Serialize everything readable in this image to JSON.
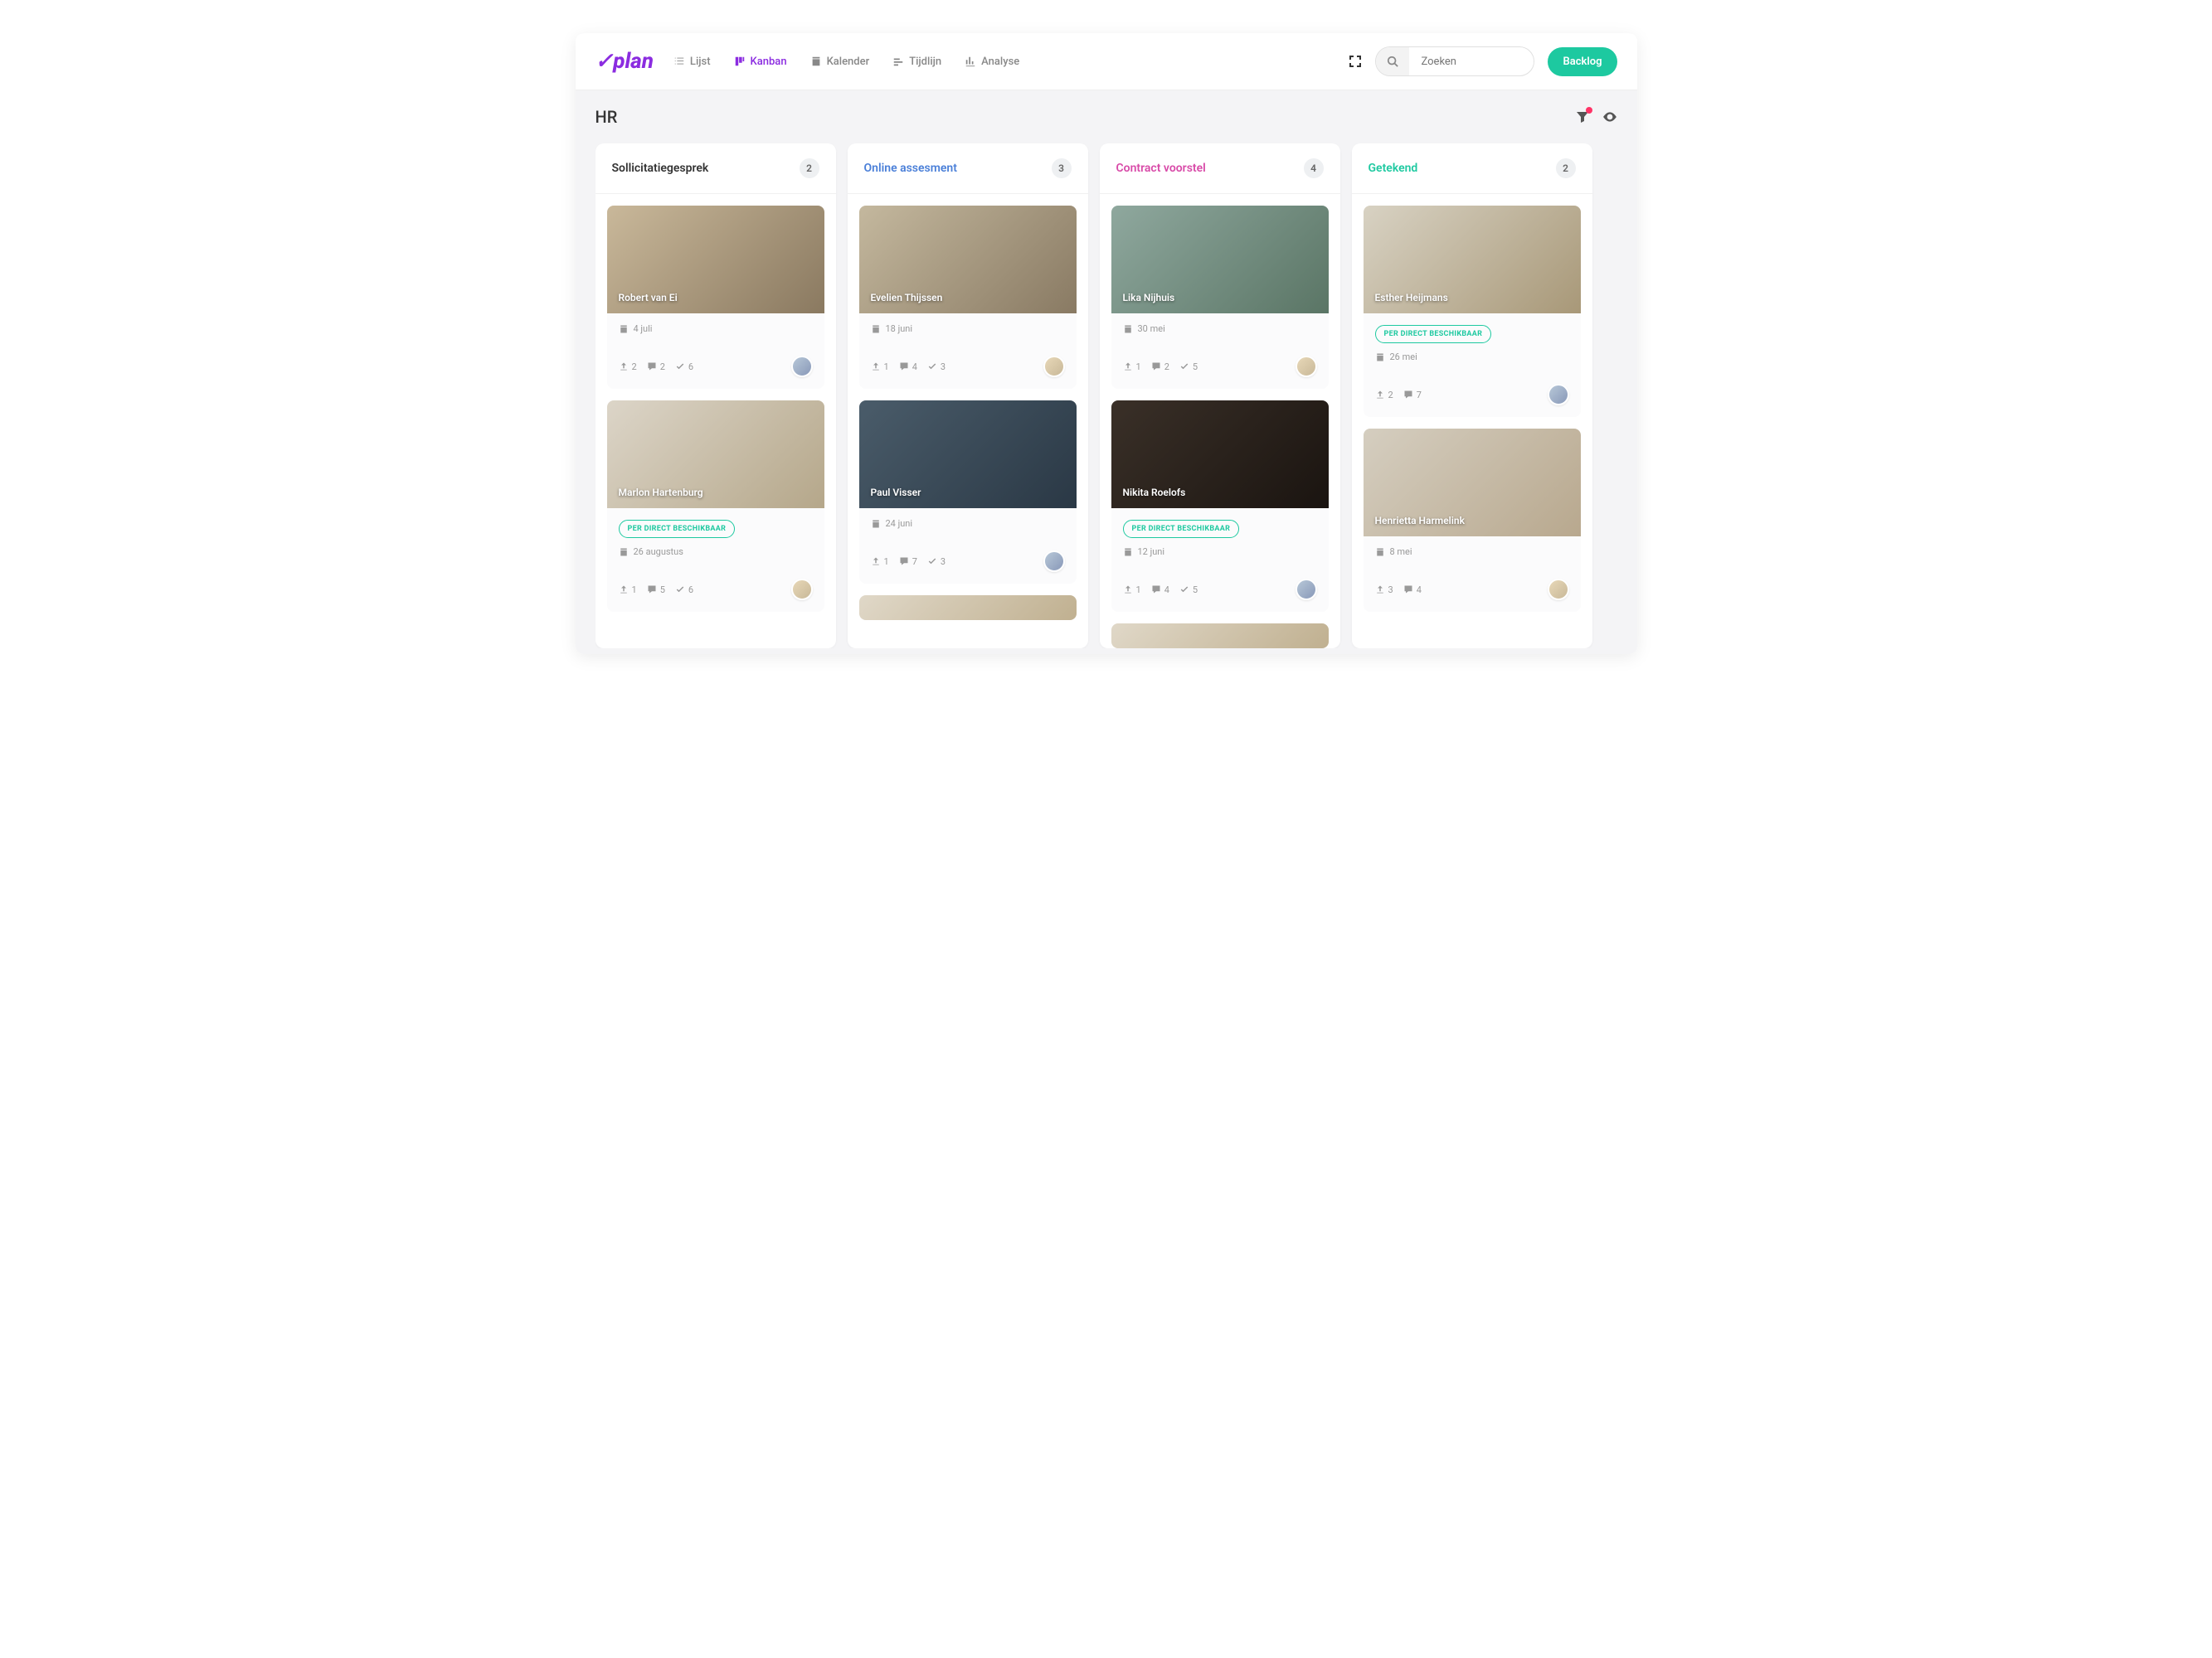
{
  "page_title": "HR",
  "logo_text": "plan",
  "nav": {
    "lijst": "Lijst",
    "kanban": "Kanban",
    "kalender": "Kalender",
    "tijdlijn": "Tijdlijn",
    "analyse": "Analyse"
  },
  "search": {
    "placeholder": "Zoeken"
  },
  "backlog_label": "Backlog",
  "badge_text": "PER DIRECT BESCHIKBAAR",
  "columns": [
    {
      "title": "Sollicitatiegesprek",
      "count": "2",
      "color_class": "c1",
      "cards": [
        {
          "name": "Robert van Ei",
          "date": "4 juli",
          "badge": false,
          "uploads": "2",
          "comments": "2",
          "checks": "6",
          "img": "p1",
          "avatar": "a3"
        },
        {
          "name": "Marlon Hartenburg",
          "date": "26 augustus",
          "badge": true,
          "uploads": "1",
          "comments": "5",
          "checks": "6",
          "img": "p2",
          "avatar": "a2"
        }
      ]
    },
    {
      "title": "Online assesment",
      "count": "3",
      "color_class": "c2",
      "cards": [
        {
          "name": "Evelien Thijssen",
          "date": "18 juni",
          "badge": false,
          "uploads": "1",
          "comments": "4",
          "checks": "3",
          "img": "p3",
          "avatar": "a2"
        },
        {
          "name": "Paul Visser",
          "date": "24 juni",
          "badge": false,
          "uploads": "1",
          "comments": "7",
          "checks": "3",
          "img": "p6",
          "avatar": "a3"
        },
        {
          "name": "",
          "date": "",
          "badge": false,
          "uploads": "",
          "comments": "",
          "checks": "",
          "img": "p9",
          "avatar": "",
          "partial": true
        }
      ]
    },
    {
      "title": "Contract voorstel",
      "count": "4",
      "color_class": "c3",
      "cards": [
        {
          "name": "Lika Nijhuis",
          "date": "30 mei",
          "badge": false,
          "uploads": "1",
          "comments": "2",
          "checks": "5",
          "img": "p5",
          "avatar": "a2"
        },
        {
          "name": "Nikita Roelofs",
          "date": "12 juni",
          "badge": true,
          "uploads": "1",
          "comments": "4",
          "checks": "5",
          "img": "p7",
          "avatar": "a3"
        },
        {
          "name": "",
          "date": "",
          "badge": false,
          "uploads": "",
          "comments": "",
          "checks": "",
          "img": "p9",
          "avatar": "",
          "partial": true
        }
      ]
    },
    {
      "title": "Getekend",
      "count": "2",
      "color_class": "c4",
      "cards": [
        {
          "name": "Esther Heijmans",
          "date": "26 mei",
          "badge": true,
          "uploads": "2",
          "comments": "7",
          "checks": "",
          "img": "p4",
          "avatar": "a3"
        },
        {
          "name": "Henrietta Harmelink",
          "date": "8 mei",
          "badge": false,
          "uploads": "3",
          "comments": "4",
          "checks": "",
          "img": "p8",
          "avatar": "a2"
        }
      ]
    }
  ]
}
